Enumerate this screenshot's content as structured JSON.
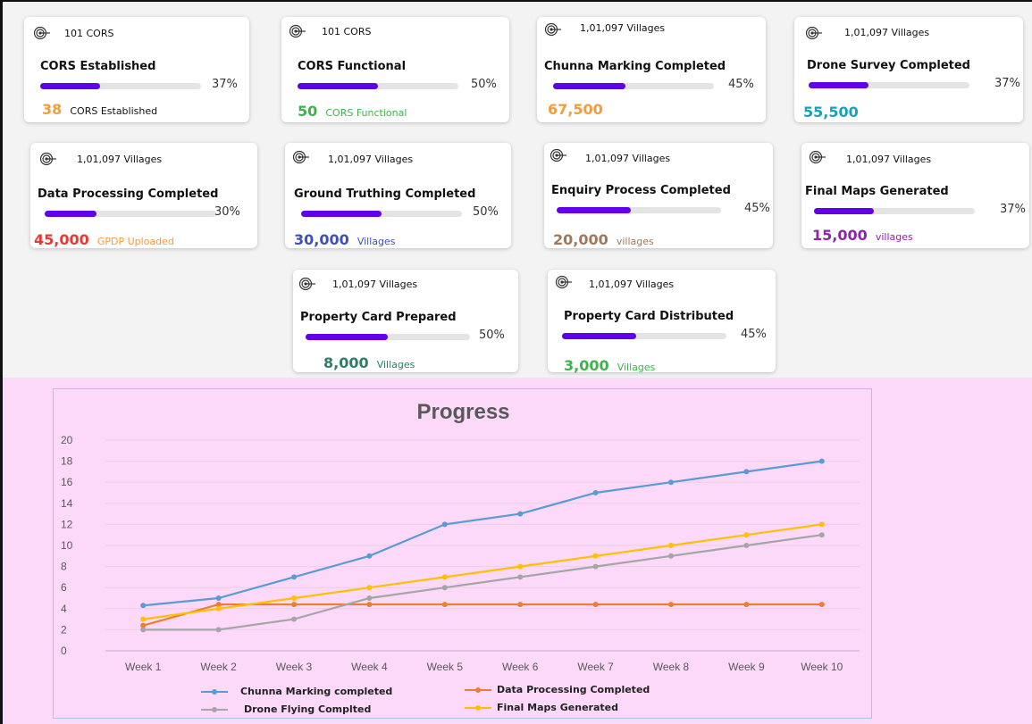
{
  "cards": [
    {
      "sub": "101 CORS",
      "title": "CORS Established",
      "pct": "37%",
      "fill": 0.37,
      "value": "38",
      "value_color": "#f39c3c",
      "label": "CORS Established",
      "label_color": "#111111"
    },
    {
      "sub": "101 CORS",
      "title": "CORS Functional",
      "pct": "50%",
      "fill": 0.5,
      "value": "50",
      "value_color": "#3cb44b",
      "label": "CORS Functional",
      "label_color": "#3cb44b"
    },
    {
      "sub": "1,01,097 Villages",
      "title": "Chunna Marking Completed",
      "pct": "45%",
      "fill": 0.45,
      "value": "67,500",
      "value_color": "#f39c3c",
      "label": "",
      "label_color": "#111111"
    },
    {
      "sub": "1,01,097 Villages",
      "title": "Drone Survey Completed",
      "pct": "37%",
      "fill": 0.37,
      "value": "55,500",
      "value_color": "#17a2b8",
      "label": "",
      "label_color": "#111111"
    },
    {
      "sub": "1,01,097 Villages",
      "title": "Data Processing Completed",
      "pct": "30%",
      "fill": 0.3,
      "value": "45,000",
      "value_color": "#e53935",
      "label": "GPDP Uploaded",
      "label_color": "#f39c3c"
    },
    {
      "sub": "1,01,097 Villages",
      "title": "Ground Truthing Completed",
      "pct": "50%",
      "fill": 0.5,
      "value": "30,000",
      "value_color": "#3f51b5",
      "label": "Villages",
      "label_color": "#3f51b5"
    },
    {
      "sub": "1,01,097 Villages",
      "title": "Enquiry Process Completed",
      "pct": "45%",
      "fill": 0.45,
      "value": "20,000",
      "value_color": "#a0785a",
      "label": "villages",
      "label_color": "#a0785a"
    },
    {
      "sub": "1,01,097 Villages",
      "title": "Final Maps Generated",
      "pct": "37%",
      "fill": 0.37,
      "value": "15,000",
      "value_color": "#8e24aa",
      "label": "villages",
      "label_color": "#8e24aa"
    },
    {
      "sub": "1,01,097 Villages",
      "title": "Property Card Prepared",
      "pct": "50%",
      "fill": 0.5,
      "value": "8,000",
      "value_color": "#2e7d6a",
      "label": "Villages",
      "label_color": "#2e7d6a"
    },
    {
      "sub": "1,01,097 Villages",
      "title": "Property Card Distributed",
      "pct": "45%",
      "fill": 0.45,
      "value": "3,000",
      "value_color": "#3cb44b",
      "label": "Villages",
      "label_color": "#3cb44b"
    }
  ],
  "icons": {
    "card_icon": "target-icon"
  },
  "chart_data": {
    "type": "line",
    "title": "Progress",
    "categories": [
      "Week 1",
      "Week 2",
      "Week 3",
      "Week 4",
      "Week 5",
      "Week 6",
      "Week 7",
      "Week 8",
      "Week 9",
      "Week 10"
    ],
    "ylim": [
      0,
      20
    ],
    "yticks": [
      "0",
      "2",
      "4",
      "6",
      "8",
      "10",
      "12",
      "14",
      "16",
      "18",
      "20"
    ],
    "grid": true,
    "legend_position": "bottom",
    "series": [
      {
        "name": "Chunna Marking completed",
        "color": "#5b9bd5",
        "values": [
          4.3,
          5,
          7,
          9,
          12,
          13,
          15,
          16,
          17,
          18
        ]
      },
      {
        "name": "Data Processing Completed",
        "color": "#ed7d31",
        "values": [
          2.4,
          4.4,
          4.4,
          4.4,
          4.4,
          4.4,
          4.4,
          4.4,
          4.4,
          4.4
        ]
      },
      {
        "name": "Drone Flying Complted",
        "color": "#a5a5a5",
        "values": [
          2,
          2,
          3,
          5,
          6,
          7,
          8,
          9,
          10,
          11
        ]
      },
      {
        "name": "Final Maps Generated",
        "color": "#ffc000",
        "values": [
          3,
          4,
          5,
          6,
          7,
          8,
          9,
          10,
          11,
          12
        ]
      }
    ]
  }
}
